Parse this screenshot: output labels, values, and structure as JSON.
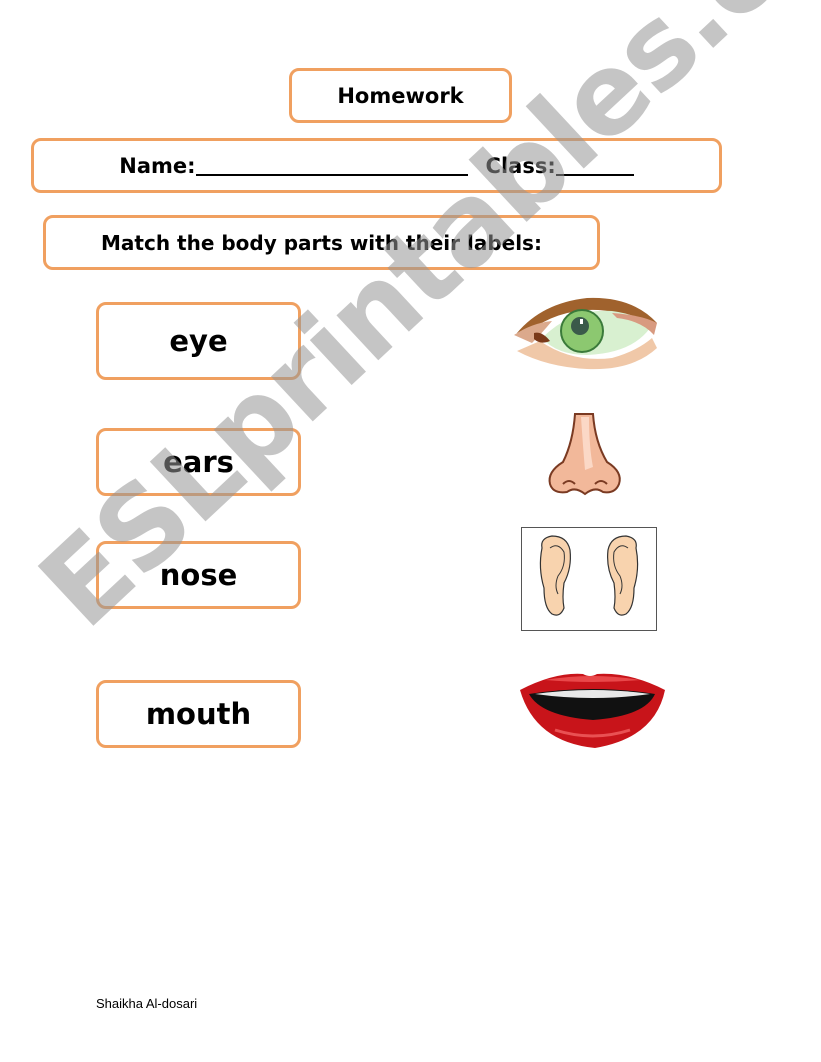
{
  "header": {
    "title": "Homework",
    "name_label": "Name:",
    "class_label": "Class:"
  },
  "instruction": "Match the body parts with their labels:",
  "labels": [
    {
      "text": "eye"
    },
    {
      "text": "ears"
    },
    {
      "text": "nose"
    },
    {
      "text": "mouth"
    }
  ],
  "pictures": [
    {
      "icon": "eye-icon"
    },
    {
      "icon": "nose-icon"
    },
    {
      "icon": "ears-icon"
    },
    {
      "icon": "mouth-icon"
    }
  ],
  "colors": {
    "border": "#f0a060",
    "watermark": "#969696"
  },
  "watermark": "ESLprintables.com",
  "footer": {
    "author": "Shaikha Al-dosari"
  }
}
